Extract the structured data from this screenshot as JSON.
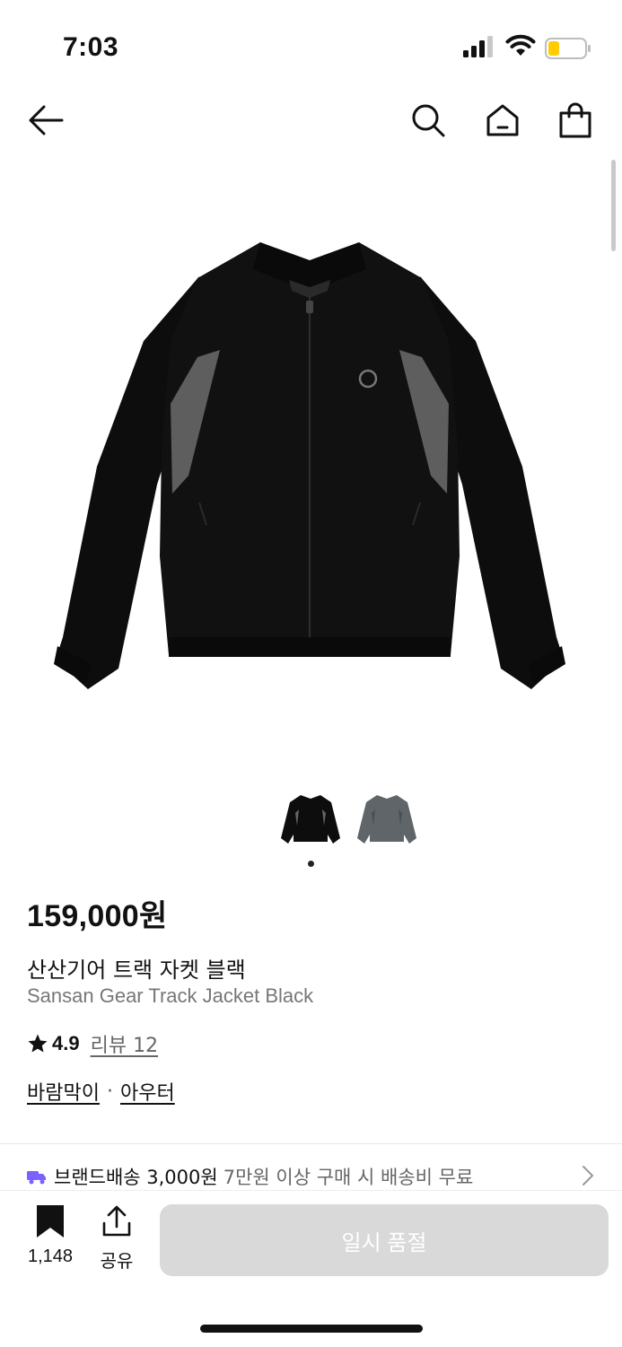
{
  "status": {
    "time": "7:03"
  },
  "nav": {
    "back_icon": "arrow-left-icon",
    "search_icon": "search-icon",
    "home_icon": "home-icon",
    "cart_icon": "shopping-bag-icon"
  },
  "product": {
    "price": "159,000원",
    "name_ko": "산산기어 트랙 자켓 블랙",
    "name_en": "Sansan Gear Track Jacket Black",
    "rating": "4.9",
    "review_label": "리뷰 12",
    "categories": [
      "바람막이",
      "아우터"
    ],
    "category_separator": "·",
    "thumbnails": [
      "black",
      "gray"
    ],
    "active_thumbnail": 1
  },
  "shipping": {
    "label": "브랜드배송 3,000원",
    "note": "7만원 이상 구매 시 배송비 무료"
  },
  "bottom": {
    "bookmark_count": "1,148",
    "share_label": "공유",
    "buy_label": "일시 품절"
  },
  "colors": {
    "accent": "#7b61ff",
    "disabled_button": "#d9d9d9",
    "battery_fill": "#ffcc00"
  }
}
